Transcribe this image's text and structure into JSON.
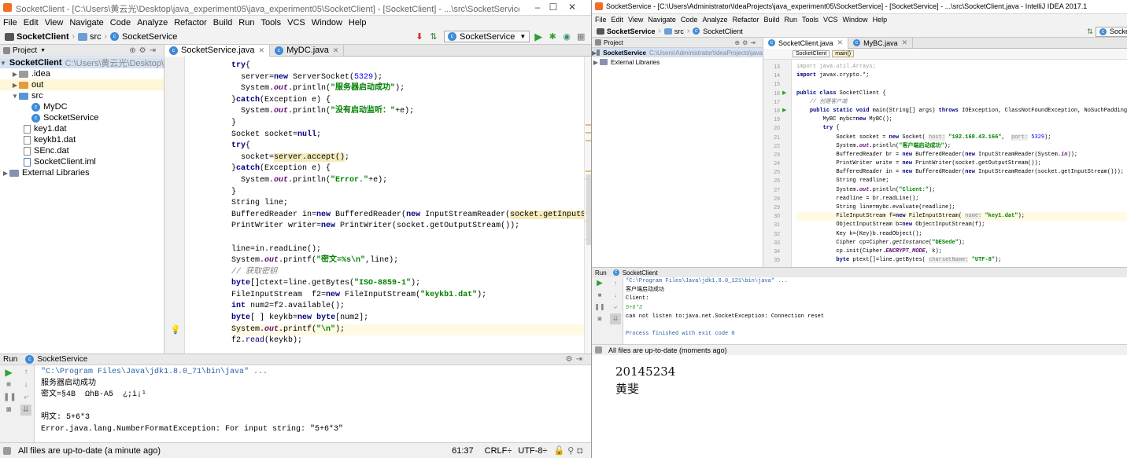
{
  "left_window": {
    "title": "SocketClient - [C:\\Users\\黄云光\\Desktop\\java_experiment05\\java_experiment05\\SocketClient] - [SocketClient] - ...\\src\\SocketService.java - IntelliJ IDEA",
    "menu": [
      "File",
      "Edit",
      "View",
      "Navigate",
      "Code",
      "Analyze",
      "Refactor",
      "Build",
      "Run",
      "Tools",
      "VCS",
      "Window",
      "Help"
    ],
    "breadcrumb": [
      "SocketClient",
      "src",
      "SocketService"
    ],
    "run_config": "SocketService",
    "project_panel": {
      "title": "Project",
      "root_name": "SocketClient",
      "root_path": "C:\\Users\\黄云光\\Desktop\\java",
      "items": [
        {
          "label": ".idea",
          "kind": "folder"
        },
        {
          "label": "out",
          "kind": "folder-orange"
        },
        {
          "label": "src",
          "kind": "folder-blue"
        },
        {
          "label": "MyDC",
          "kind": "class"
        },
        {
          "label": "SocketService",
          "kind": "class"
        },
        {
          "label": "key1.dat",
          "kind": "file"
        },
        {
          "label": "keykb1.dat",
          "kind": "file"
        },
        {
          "label": "SEnc.dat",
          "kind": "file"
        },
        {
          "label": "SocketClient.iml",
          "kind": "file"
        },
        {
          "label": "External Libraries",
          "kind": "lib"
        }
      ]
    },
    "tabs": [
      "SocketService.java",
      "MyDC.java"
    ],
    "code": [
      "    try{",
      "      server=new ServerSocket(5329);",
      "      System.out.println(\"服务器启动成功\");",
      "    }catch(Exception e) {",
      "      System.out.println(\"没有启动监听：\"+e);",
      "    }",
      "    Socket socket=null;",
      "    try{",
      "      socket=server.accept();",
      "    }catch(Exception e) {",
      "      System.out.println(\"Error.\"+e);",
      "    }",
      "    String line;",
      "    BufferedReader in=new BufferedReader(new InputStreamReader(socket.getInputStream()));",
      "    PrintWriter writer=new PrintWriter(socket.getOutputStream());",
      "",
      "    line=in.readLine();",
      "    System.out.printf(\"密文=%s\\n\",line);",
      "    // 获取密钥",
      "    byte[]ctext=line.getBytes(\"ISO-8859-1\");",
      "    FileInputStream  f2=new FileInputStream(\"keykb1.dat\");",
      "    int num2=f2.available();",
      "    byte[ ] keykb=new byte[num2];",
      "    System.out.printf(\"\\n\");",
      "    f2.read(keykb);"
    ],
    "run_panel": {
      "label": "Run",
      "config": "SocketService",
      "console": [
        "\"C:\\Program Files\\Java\\jdk1.8.0_71\\bin\\java\" ...",
        "服务器启动成功",
        "密文=§4B  ΩhB-A5  ¿;ì¡¹",
        "",
        "明文: 5+6*3",
        "Error.java.lang.NumberFormatException: For input string: \"5+6*3\""
      ]
    },
    "status": {
      "message": "All files are up-to-date (a minute ago)",
      "position": "61:37",
      "line_sep": "CRLF÷",
      "encoding": "UTF-8÷"
    }
  },
  "right_window": {
    "title": "SocketService - [C:\\Users\\Administrator\\IdeaProjects\\java_experiment05\\SocketService] - [SocketService] - ...\\src\\SocketClient.java - IntelliJ IDEA 2017.1",
    "menu": [
      "File",
      "Edit",
      "View",
      "Navigate",
      "Code",
      "Analyze",
      "Refactor",
      "Build",
      "Run",
      "Tools",
      "VCS",
      "Window",
      "Help"
    ],
    "breadcrumb": [
      "SocketService",
      "src",
      "SocketClient"
    ],
    "run_config": "SocketClient",
    "project_panel": {
      "title": "Project",
      "root_name": "SocketService",
      "root_path": "C:\\Users\\Administrator\\IdeaProjects\\java",
      "lib": "External Libraries"
    },
    "tabs": [
      "SocketClient.java",
      "MyBC.java"
    ],
    "crumbs": [
      "SocketClient",
      "main()"
    ],
    "line_numbers": [
      "13",
      "14",
      "15",
      "16",
      "17",
      "18",
      "19",
      "20",
      "21",
      "22",
      "23",
      "24",
      "25",
      "26",
      "27",
      "28",
      "29",
      "30",
      "31",
      "32",
      "33",
      "34",
      "35"
    ],
    "code": [
      "import java.util.Arrays;",
      "import javax.crypto.*;",
      "",
      "public class SocketClient {",
      "    // 创建客户端",
      "    public static void main(String[] args) throws IOException, ClassNotFoundException, NoSuchPaddingException, NoSuc",
      "        MyBC mybc=new MyBC();",
      "        try {",
      "            Socket socket = new Socket( host: \"192.168.43.166\",  port: 5329);",
      "            System.out.println(\"客户端启动成功\");",
      "            BufferedReader br = new BufferedReader(new InputStreamReader(System.in));",
      "            PrintWriter write = new PrintWriter(socket.getOutputStream());",
      "            BufferedReader in = new BufferedReader(new InputStreamReader(socket.getInputStream()));",
      "            String readline;",
      "            System.out.println(\"Client:\");",
      "            readline = br.readLine();",
      "            String line=mybc.evaluate(readline);",
      "            FileInputStream f=new FileInputStream(  name: \"key1.dat\");",
      "            ObjectInputStream b=new ObjectInputStream(f);",
      "            Key k=(Key)b.readObject();",
      "            Cipher cp=Cipher.getInstance(\"DESede\");",
      "            cp.init(Cipher.ENCRYPT_MODE, k);",
      "            byte ptext[]=line.getBytes(  charsetName: \"UTF-8\");"
    ],
    "run_panel": {
      "label": "Run",
      "config": "SocketClient",
      "console": [
        "\"C:\\Program Files\\Java\\jdk1.8.0_121\\bin\\java\" ...",
        "客户端启动成功",
        "Client:",
        "5+6*3",
        "can not listen to:java.net.SocketException: Connection reset",
        "",
        "Process finished with exit code 0"
      ]
    },
    "status": "All files are up-to-date (moments ago)"
  },
  "note": {
    "student_id": "20145234",
    "name": "黄斐"
  },
  "colors": {
    "keyword": "#000080",
    "string": "#008000",
    "field": "#660e7a",
    "comment": "#808080",
    "run_green": "#2fa02f",
    "stop_red": "#d7301f",
    "highlight": "#f6ebbc"
  }
}
